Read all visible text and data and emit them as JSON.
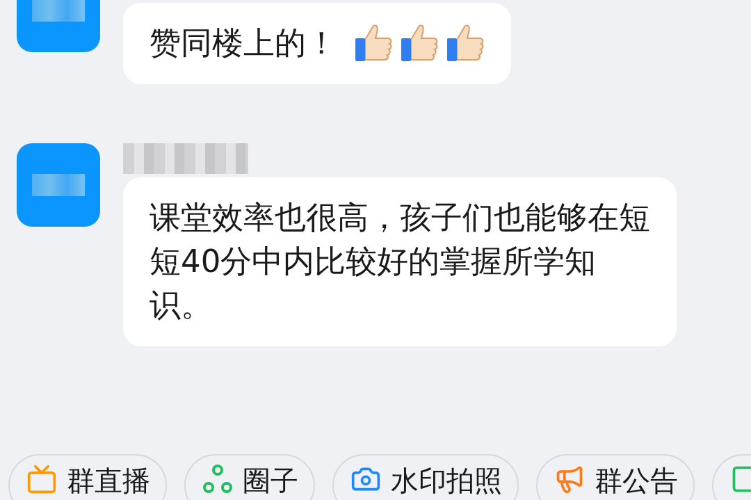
{
  "messages": [
    {
      "text": "赞同楼上的！",
      "reactions": [
        {
          "kind": "thumbs-up"
        },
        {
          "kind": "thumbs-up"
        },
        {
          "kind": "thumbs-up"
        }
      ]
    },
    {
      "text": "课堂效率也很高，孩子们也能够在短短40分中内比较好的掌握所学知识。"
    }
  ],
  "shortcuts": [
    {
      "label": "群直播",
      "kind": "live",
      "color": "#ff9900"
    },
    {
      "label": "圈子",
      "kind": "circle",
      "color": "#1dbf5e"
    },
    {
      "label": "水印拍照",
      "kind": "camera",
      "color": "#1e88ff"
    },
    {
      "label": "群公告",
      "kind": "announce",
      "color": "#ff7a1a"
    },
    {
      "kind": "more",
      "color": "#1dbf5e"
    }
  ]
}
